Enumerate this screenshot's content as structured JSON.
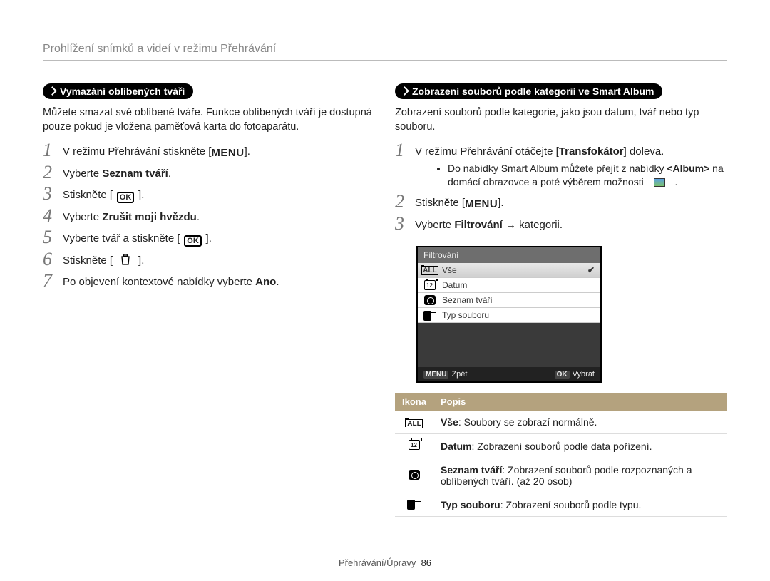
{
  "page_title": "Prohlížení snímků a videí v režimu Přehrávání",
  "footer": {
    "section": "Přehrávání/Úpravy",
    "page": "86"
  },
  "left": {
    "badge": "Vymazání oblíbených tváří",
    "intro": "Můžete smazat své oblíbené tváře. Funkce oblíbených tváří je dostupná pouze pokud je vložena paměťová karta do fotoaparátu.",
    "steps": [
      {
        "parts": [
          {
            "t": "V režimu Přehrávání stiskněte ["
          },
          {
            "icon": "menu"
          },
          {
            "t": "]."
          }
        ]
      },
      {
        "parts": [
          {
            "t": "Vyberte "
          },
          {
            "t": "Seznam tváří",
            "b": true
          },
          {
            "t": "."
          }
        ]
      },
      {
        "parts": [
          {
            "t": "Stiskněte ["
          },
          {
            "icon": "ok"
          },
          {
            "t": "]."
          }
        ]
      },
      {
        "parts": [
          {
            "t": "Vyberte "
          },
          {
            "t": "Zrušit moji hvězdu",
            "b": true
          },
          {
            "t": "."
          }
        ]
      },
      {
        "parts": [
          {
            "t": "Vyberte tvář a stiskněte ["
          },
          {
            "icon": "ok"
          },
          {
            "t": "]."
          }
        ]
      },
      {
        "parts": [
          {
            "t": "Stiskněte ["
          },
          {
            "icon": "trash"
          },
          {
            "t": "]."
          }
        ]
      },
      {
        "parts": [
          {
            "t": "Po objevení kontextové nabídky vyberte "
          },
          {
            "t": "Ano",
            "b": true
          },
          {
            "t": "."
          }
        ]
      }
    ]
  },
  "right": {
    "badge": "Zobrazení souborů podle kategorií ve Smart Album",
    "intro": "Zobrazení souborů podle kategorie, jako jsou datum, tvář nebo typ souboru.",
    "steps": [
      {
        "parts": [
          {
            "t": "V režimu Přehrávání otáčejte ["
          },
          {
            "t": "Transfokátor",
            "b": true
          },
          {
            "t": "] doleva."
          }
        ],
        "sub": [
          {
            "parts": [
              {
                "t": "Do nabídky Smart Album můžete přejít z nabídky "
              },
              {
                "t": "<Album>",
                "b": true
              },
              {
                "t": " na domácí obrazovce a poté výběrem možnosti "
              },
              {
                "icon": "thumb"
              },
              {
                "t": " ."
              }
            ]
          }
        ]
      },
      {
        "parts": [
          {
            "t": "Stiskněte ["
          },
          {
            "icon": "menu"
          },
          {
            "t": "]."
          }
        ]
      },
      {
        "parts": [
          {
            "t": "Vyberte "
          },
          {
            "t": "Filtrování",
            "b": true
          },
          {
            "t": " → kategorii."
          }
        ]
      }
    ],
    "screen": {
      "title": "Filtrování",
      "rows": [
        {
          "icon": "all",
          "label": "Vše",
          "selected": true
        },
        {
          "icon": "cal",
          "label": "Datum"
        },
        {
          "icon": "face",
          "label": "Seznam tváří"
        },
        {
          "icon": "type",
          "label": "Typ souboru"
        }
      ],
      "footer": {
        "left_key": "MENU",
        "left": "Zpět",
        "right_key": "OK",
        "right": "Vybrat"
      }
    },
    "table": {
      "headers": {
        "icon": "Ikona",
        "desc": "Popis"
      },
      "rows": [
        {
          "icon": "all",
          "title": "Vše",
          "desc": ": Soubory se zobrazí normálně."
        },
        {
          "icon": "cal",
          "title": "Datum",
          "desc": ": Zobrazení souborů podle data pořízení."
        },
        {
          "icon": "face",
          "title": "Seznam tváří",
          "desc": ": Zobrazení souborů podle rozpoznaných a oblíbených tváří. (až 20 osob)"
        },
        {
          "icon": "type",
          "title": "Typ souboru",
          "desc": ": Zobrazení souborů podle typu."
        }
      ]
    }
  }
}
